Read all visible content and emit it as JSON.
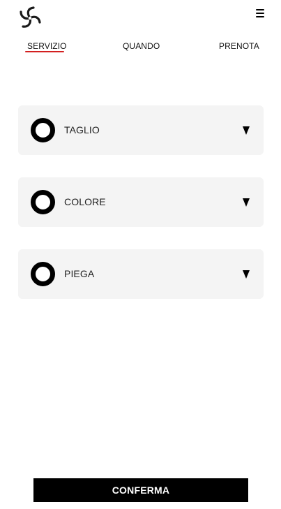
{
  "header": {
    "logo_icon": "swirl-logo-icon",
    "menu_icon": "hamburger-menu-icon"
  },
  "tabs": [
    {
      "label": "SERVIZIO",
      "active": true
    },
    {
      "label": "QUANDO",
      "active": false
    },
    {
      "label": "PRENOTA",
      "active": false
    }
  ],
  "services": [
    {
      "label": "TAGLIO",
      "selected": false
    },
    {
      "label": "COLORE",
      "selected": false
    },
    {
      "label": "PIEGA",
      "selected": false
    }
  ],
  "confirm": {
    "label": "CONFERMA"
  },
  "colors": {
    "accent": "#d32020",
    "card_bg": "#f4f4f4",
    "button_bg": "#000000"
  }
}
